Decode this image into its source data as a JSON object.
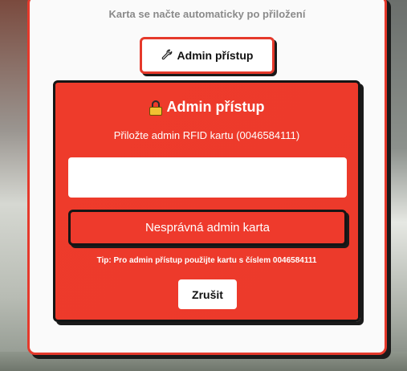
{
  "card": {
    "hint": "Karta se načte automaticky po přiložení",
    "admin_button_label": "Admin přístup",
    "admin_button_icon": "wrench-icon"
  },
  "modal": {
    "title": "Admin přístup",
    "title_icon": "lock-icon",
    "subtitle": "Přiložte admin RFID kartu (0046584111)",
    "input_value": "",
    "error_message": "Nesprávná admin karta",
    "tip": "Tip: Pro admin přístup použijte kartu s číslem 0046584111",
    "cancel_label": "Zrušit"
  },
  "colors": {
    "accent": "#e5392b",
    "panel": "#ee3b2b",
    "outline": "#151515",
    "hint_text": "#8a8a8a"
  }
}
